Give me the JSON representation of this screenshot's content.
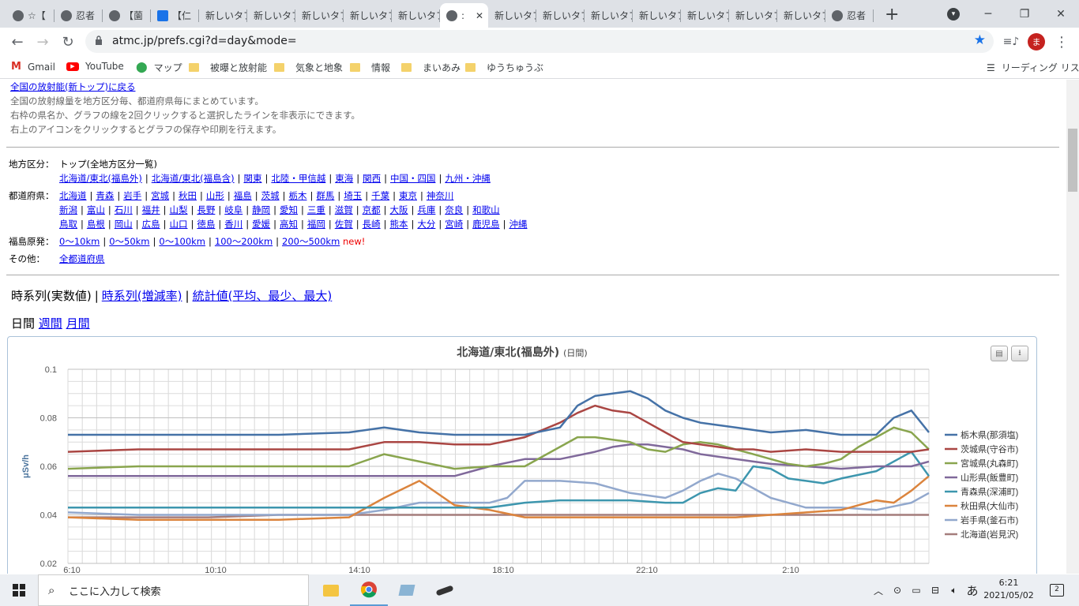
{
  "browser": {
    "tabs": [
      {
        "label": "☆【",
        "icon": "globe"
      },
      {
        "label": "忍者",
        "icon": "globe"
      },
      {
        "label": "【薗",
        "icon": "globe"
      },
      {
        "label": "【仁",
        "icon": "rn"
      },
      {
        "label": "新しいタブ",
        "icon": "none"
      },
      {
        "label": "新しいタブ",
        "icon": "none"
      },
      {
        "label": "新しいタブ",
        "icon": "none"
      },
      {
        "label": "新しいタブ",
        "icon": "none"
      },
      {
        "label": "新しいタブ",
        "icon": "none"
      },
      {
        "label": ":",
        "icon": "globe",
        "active": true
      },
      {
        "label": "新しいタブ",
        "icon": "none"
      },
      {
        "label": "新しいタブ",
        "icon": "none"
      },
      {
        "label": "新しいタブ",
        "icon": "none"
      },
      {
        "label": "新しいタブ",
        "icon": "none"
      },
      {
        "label": "新しいタブ",
        "icon": "none"
      },
      {
        "label": "新しいタブ",
        "icon": "none"
      },
      {
        "label": "新しいタブ",
        "icon": "none"
      },
      {
        "label": "忍者",
        "icon": "globe"
      }
    ],
    "url": "atmc.jp/prefs.cgi?d=day&mode=",
    "profile_initial": "ま",
    "bookmarks": [
      {
        "label": "Gmail",
        "icon": "gmail-icon"
      },
      {
        "label": "YouTube",
        "icon": "youtube-icon"
      },
      {
        "label": "マップ",
        "icon": "maps-icon"
      },
      {
        "label": "被曝と放射能",
        "icon": "folder-icon"
      },
      {
        "label": "気象と地象",
        "icon": "folder-icon"
      },
      {
        "label": "情報",
        "icon": "folder-icon"
      },
      {
        "label": "まいあみ",
        "icon": "folder-icon"
      },
      {
        "label": "ゆうちゅうぶ",
        "icon": "folder-icon"
      }
    ],
    "reading_list": "リーディング リスト"
  },
  "page": {
    "intro_link": "全国の放射能(新トップ)に戻る",
    "intro_lines": [
      "全国の放射線量を地方区分毎、都道府県毎にまとめています。",
      "右枠の県名か、グラフの線を2回クリックすると選択したラインを非表示にできます。",
      "右上のアイコンをクリックするとグラフの保存や印刷を行えます。"
    ],
    "region_label": "地方区分：",
    "region_top": "トップ(全地方区分一覧)",
    "regions": [
      "北海道/東北(福島外)",
      "北海道/東北(福島含)",
      "関東",
      "北陸・甲信越",
      "東海",
      "関西",
      "中国・四国",
      "九州・沖縄"
    ],
    "pref_label": "都道府県：",
    "prefs_row1": [
      "北海道",
      "青森",
      "岩手",
      "宮城",
      "秋田",
      "山形",
      "福島",
      "茨城",
      "栃木",
      "群馬",
      "埼玉",
      "千葉",
      "東京",
      "神奈川"
    ],
    "prefs_row2": [
      "新潟",
      "富山",
      "石川",
      "福井",
      "山梨",
      "長野",
      "岐阜",
      "静岡",
      "愛知",
      "三重",
      "滋賀",
      "京都",
      "大阪",
      "兵庫",
      "奈良",
      "和歌山"
    ],
    "prefs_row3": [
      "鳥取",
      "島根",
      "岡山",
      "広島",
      "山口",
      "徳島",
      "香川",
      "愛媛",
      "高知",
      "福岡",
      "佐賀",
      "長崎",
      "熊本",
      "大分",
      "宮崎",
      "鹿児島",
      "沖縄"
    ],
    "fukushima_label": "福島原発：",
    "fukushima": [
      "0～10km",
      "0～50km",
      "0～100km",
      "100～200km",
      "200～500km"
    ],
    "new_badge": "new!",
    "other_label": "その他：",
    "other_link": "全都道府県",
    "view_current": "時系列(実数値)",
    "view_links": [
      "時系列(増減率)",
      "統計値(平均、最少、最大)"
    ],
    "period_current": "日間",
    "period_links": [
      "週間",
      "月間"
    ]
  },
  "chart_data": {
    "type": "line",
    "title": "北海道/東北(福島外)",
    "subtitle": "(日間)",
    "ylabel": "μSv/h",
    "ylim": [
      0.02,
      0.1
    ],
    "yticks": [
      "0.1",
      "0.08",
      "0.06",
      "0.04",
      "0.02"
    ],
    "xticks": [
      "6:10",
      "10:10",
      "14:10",
      "18:10",
      "22:10",
      "2:10"
    ],
    "x_range": [
      0,
      24.5
    ],
    "legend_position": "right",
    "series": [
      {
        "name": "栃木県(那須塩)",
        "color": "#4572a7",
        "points": [
          [
            0,
            0.073
          ],
          [
            2,
            0.073
          ],
          [
            4,
            0.073
          ],
          [
            6,
            0.073
          ],
          [
            8,
            0.074
          ],
          [
            9,
            0.076
          ],
          [
            10,
            0.074
          ],
          [
            11,
            0.073
          ],
          [
            12,
            0.073
          ],
          [
            13,
            0.073
          ],
          [
            14,
            0.076
          ],
          [
            14.5,
            0.085
          ],
          [
            15,
            0.089
          ],
          [
            15.5,
            0.09
          ],
          [
            16,
            0.091
          ],
          [
            16.5,
            0.088
          ],
          [
            17,
            0.083
          ],
          [
            17.5,
            0.08
          ],
          [
            18,
            0.078
          ],
          [
            18.5,
            0.077
          ],
          [
            19,
            0.076
          ],
          [
            19.5,
            0.075
          ],
          [
            20,
            0.074
          ],
          [
            21,
            0.075
          ],
          [
            22,
            0.073
          ],
          [
            22.5,
            0.073
          ],
          [
            23,
            0.073
          ],
          [
            23.5,
            0.08
          ],
          [
            24,
            0.083
          ],
          [
            24.5,
            0.074
          ]
        ]
      },
      {
        "name": "茨城県(守谷市)",
        "color": "#aa4643",
        "points": [
          [
            0,
            0.066
          ],
          [
            2,
            0.067
          ],
          [
            4,
            0.067
          ],
          [
            6,
            0.067
          ],
          [
            8,
            0.067
          ],
          [
            9,
            0.07
          ],
          [
            10,
            0.07
          ],
          [
            11,
            0.069
          ],
          [
            12,
            0.069
          ],
          [
            13,
            0.072
          ],
          [
            14,
            0.078
          ],
          [
            14.5,
            0.082
          ],
          [
            15,
            0.085
          ],
          [
            15.5,
            0.083
          ],
          [
            16,
            0.082
          ],
          [
            16.5,
            0.078
          ],
          [
            17,
            0.074
          ],
          [
            17.5,
            0.07
          ],
          [
            18,
            0.069
          ],
          [
            18.5,
            0.068
          ],
          [
            19,
            0.067
          ],
          [
            19.5,
            0.067
          ],
          [
            20,
            0.066
          ],
          [
            21,
            0.067
          ],
          [
            22,
            0.066
          ],
          [
            23,
            0.066
          ],
          [
            24,
            0.066
          ],
          [
            24.5,
            0.067
          ]
        ]
      },
      {
        "name": "宮城県(丸森町)",
        "color": "#89a54e",
        "points": [
          [
            0,
            0.059
          ],
          [
            2,
            0.06
          ],
          [
            4,
            0.06
          ],
          [
            6,
            0.06
          ],
          [
            8,
            0.06
          ],
          [
            9,
            0.065
          ],
          [
            10,
            0.062
          ],
          [
            11,
            0.059
          ],
          [
            12,
            0.06
          ],
          [
            13,
            0.06
          ],
          [
            14,
            0.068
          ],
          [
            14.5,
            0.072
          ],
          [
            15,
            0.072
          ],
          [
            15.5,
            0.071
          ],
          [
            16,
            0.07
          ],
          [
            16.5,
            0.067
          ],
          [
            17,
            0.066
          ],
          [
            17.5,
            0.069
          ],
          [
            18,
            0.07
          ],
          [
            18.5,
            0.069
          ],
          [
            19,
            0.067
          ],
          [
            19.5,
            0.065
          ],
          [
            20,
            0.063
          ],
          [
            20.5,
            0.061
          ],
          [
            21,
            0.06
          ],
          [
            21.5,
            0.061
          ],
          [
            22,
            0.063
          ],
          [
            22.5,
            0.068
          ],
          [
            23,
            0.072
          ],
          [
            23.5,
            0.076
          ],
          [
            24,
            0.074
          ],
          [
            24.5,
            0.067
          ]
        ]
      },
      {
        "name": "山形県(飯豊町)",
        "color": "#80699b",
        "points": [
          [
            0,
            0.056
          ],
          [
            2,
            0.056
          ],
          [
            4,
            0.056
          ],
          [
            6,
            0.056
          ],
          [
            8,
            0.056
          ],
          [
            9,
            0.056
          ],
          [
            10,
            0.056
          ],
          [
            11,
            0.056
          ],
          [
            12,
            0.06
          ],
          [
            13,
            0.063
          ],
          [
            14,
            0.063
          ],
          [
            15,
            0.066
          ],
          [
            15.5,
            0.068
          ],
          [
            16,
            0.069
          ],
          [
            16.5,
            0.069
          ],
          [
            17,
            0.068
          ],
          [
            17.5,
            0.067
          ],
          [
            18,
            0.065
          ],
          [
            18.5,
            0.064
          ],
          [
            19,
            0.063
          ],
          [
            19.5,
            0.062
          ],
          [
            20,
            0.061
          ],
          [
            21,
            0.06
          ],
          [
            22,
            0.059
          ],
          [
            23,
            0.06
          ],
          [
            24,
            0.06
          ],
          [
            24.5,
            0.062
          ]
        ]
      },
      {
        "name": "青森県(深浦町)",
        "color": "#3d96ae",
        "points": [
          [
            0,
            0.043
          ],
          [
            2,
            0.043
          ],
          [
            4,
            0.043
          ],
          [
            6,
            0.043
          ],
          [
            8,
            0.043
          ],
          [
            9,
            0.043
          ],
          [
            10,
            0.043
          ],
          [
            11,
            0.043
          ],
          [
            12,
            0.043
          ],
          [
            13,
            0.045
          ],
          [
            14,
            0.046
          ],
          [
            15,
            0.046
          ],
          [
            16,
            0.046
          ],
          [
            17,
            0.045
          ],
          [
            17.5,
            0.045
          ],
          [
            18,
            0.049
          ],
          [
            18.5,
            0.051
          ],
          [
            19,
            0.05
          ],
          [
            19.5,
            0.06
          ],
          [
            20,
            0.059
          ],
          [
            20.5,
            0.055
          ],
          [
            21,
            0.054
          ],
          [
            21.5,
            0.053
          ],
          [
            22,
            0.055
          ],
          [
            23,
            0.058
          ],
          [
            24,
            0.066
          ],
          [
            24.5,
            0.056
          ]
        ]
      },
      {
        "name": "秋田県(大仙市)",
        "color": "#db843d",
        "points": [
          [
            0,
            0.039
          ],
          [
            2,
            0.038
          ],
          [
            4,
            0.038
          ],
          [
            6,
            0.038
          ],
          [
            8,
            0.039
          ],
          [
            9,
            0.047
          ],
          [
            10,
            0.054
          ],
          [
            11,
            0.044
          ],
          [
            12,
            0.042
          ],
          [
            13,
            0.039
          ],
          [
            14,
            0.039
          ],
          [
            15,
            0.039
          ],
          [
            16,
            0.039
          ],
          [
            17,
            0.039
          ],
          [
            18,
            0.039
          ],
          [
            19,
            0.039
          ],
          [
            20,
            0.04
          ],
          [
            21,
            0.041
          ],
          [
            22,
            0.042
          ],
          [
            23,
            0.046
          ],
          [
            23.5,
            0.045
          ],
          [
            24,
            0.05
          ],
          [
            24.5,
            0.056
          ]
        ]
      },
      {
        "name": "岩手県(釜石市)",
        "color": "#92a8cd",
        "points": [
          [
            0,
            0.041
          ],
          [
            2,
            0.04
          ],
          [
            4,
            0.04
          ],
          [
            6,
            0.04
          ],
          [
            8,
            0.04
          ],
          [
            9,
            0.042
          ],
          [
            10,
            0.045
          ],
          [
            11,
            0.045
          ],
          [
            12,
            0.045
          ],
          [
            12.5,
            0.047
          ],
          [
            13,
            0.054
          ],
          [
            14,
            0.054
          ],
          [
            15,
            0.053
          ],
          [
            16,
            0.049
          ],
          [
            17,
            0.047
          ],
          [
            17.5,
            0.05
          ],
          [
            18,
            0.054
          ],
          [
            18.5,
            0.057
          ],
          [
            19,
            0.055
          ],
          [
            20,
            0.047
          ],
          [
            21,
            0.043
          ],
          [
            22,
            0.043
          ],
          [
            23,
            0.042
          ],
          [
            24,
            0.045
          ],
          [
            24.5,
            0.049
          ]
        ]
      },
      {
        "name": "北海道(岩見沢)",
        "color": "#a47d7c",
        "points": [
          [
            0,
            0.039
          ],
          [
            2,
            0.039
          ],
          [
            4,
            0.039
          ],
          [
            6,
            0.04
          ],
          [
            8,
            0.04
          ],
          [
            10,
            0.04
          ],
          [
            12,
            0.04
          ],
          [
            14,
            0.04
          ],
          [
            16,
            0.04
          ],
          [
            18,
            0.04
          ],
          [
            20,
            0.04
          ],
          [
            22,
            0.04
          ],
          [
            24,
            0.04
          ],
          [
            24.5,
            0.04
          ]
        ]
      }
    ]
  },
  "taskbar": {
    "search_placeholder": "ここに入力して検索",
    "ime": "あ",
    "time": "6:21",
    "date": "2021/05/02",
    "notifications": "2"
  }
}
